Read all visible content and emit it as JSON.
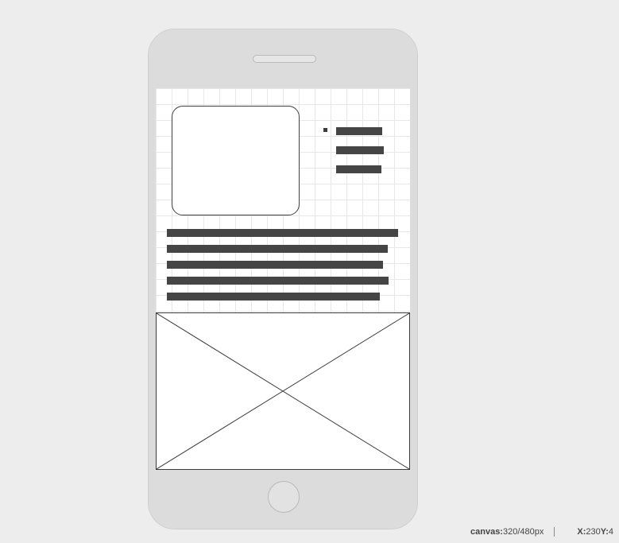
{
  "status_bar": {
    "canvas_label": "canvas:",
    "canvas_value": " 320/480px",
    "x_label": "X:",
    "x_value": " 230 ",
    "y_label": "Y:",
    "y_value": " 4"
  },
  "colors": {
    "background": "#ededed",
    "phone_body": "#dcdcdc",
    "screen": "#ffffff",
    "grid": "#e7e7e7",
    "text_bar": "#454545"
  },
  "icons": {
    "bullet": "square-bullet-icon",
    "placeholder": "image-placeholder-icon"
  }
}
